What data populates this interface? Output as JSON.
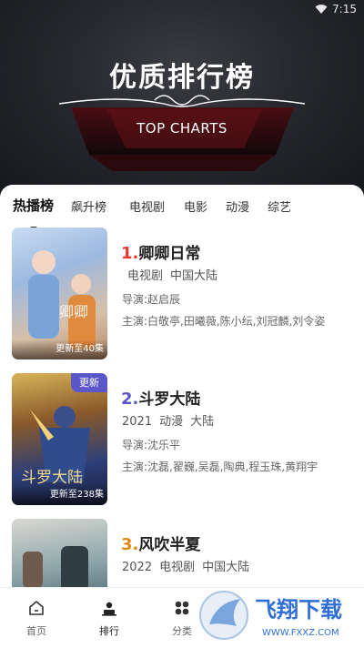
{
  "status_bar": {
    "time": "7:15",
    "wifi_icon": "wifi-icon"
  },
  "hero": {
    "title": "优质排行榜",
    "subtitle": "TOP CHARTS"
  },
  "tabs": [
    {
      "label": "热播榜",
      "active": true
    },
    {
      "label": "飙升榜"
    },
    {
      "label": "电视剧"
    },
    {
      "label": "电影"
    },
    {
      "label": "动漫"
    },
    {
      "label": "综艺"
    }
  ],
  "items": [
    {
      "rank_num": "1.",
      "title": "卿卿日常",
      "meta": [
        "电视剧",
        "中国大陆"
      ],
      "director_label": "导演:",
      "director": "赵启辰",
      "cast_label": "主演:",
      "cast": "白敬亭,田曦薇,陈小纭,刘冠麟,刘令姿",
      "poster_status": "更新至40集",
      "rank_color": "#e53935"
    },
    {
      "rank_num": "2.",
      "title": "斗罗大陆",
      "meta": [
        "2021",
        "动漫",
        "大陆"
      ],
      "director_label": "导演:",
      "director": "沈乐平",
      "cast_label": "主演:",
      "cast": "沈磊,翟巍,吴磊,陶典,程玉珠,黄翔宇",
      "poster_status": "更新至238集",
      "badge": "更新",
      "rank_color": "#5b57c9"
    },
    {
      "rank_num": "3.",
      "title": "风吹半夏",
      "meta": [
        "2022",
        "电视剧",
        "中国大陆"
      ],
      "rank_color": "#e08a1e"
    }
  ],
  "bottom_nav": [
    {
      "label": "首页",
      "icon": "home-icon"
    },
    {
      "label": "排行",
      "icon": "ranking-icon",
      "active": true
    },
    {
      "label": "分类",
      "icon": "category-icon"
    }
  ],
  "watermark": {
    "text": "飞翔下载",
    "url": "WWW.FXXZ.COM"
  }
}
